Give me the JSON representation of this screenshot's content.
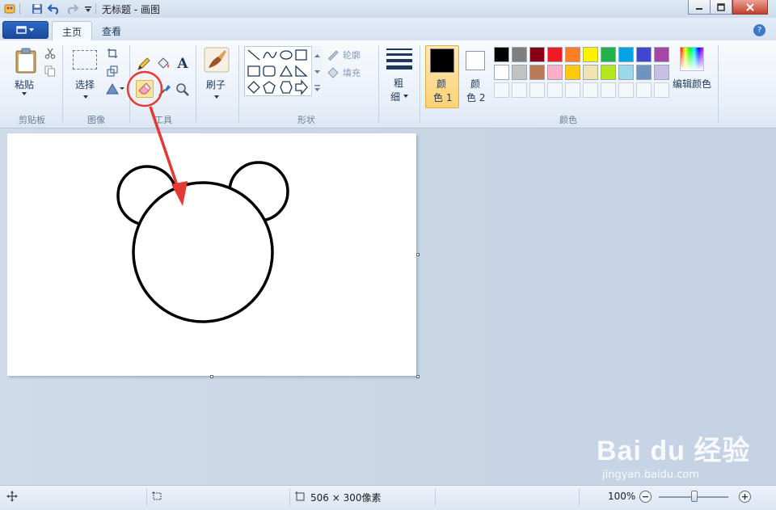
{
  "window": {
    "title": "无标题 - 画图"
  },
  "tabs": [
    {
      "label": "主页"
    },
    {
      "label": "查看"
    }
  ],
  "help_glyph": "?",
  "ribbon": {
    "clipboard": {
      "paste": "粘贴",
      "group": "剪贴板"
    },
    "image": {
      "select": "选择",
      "group": "图像"
    },
    "tools": {
      "group": "工具",
      "text_glyph": "A"
    },
    "brushes": {
      "label": "刷子"
    },
    "shapes": {
      "outline": "轮廓",
      "fill": "填充",
      "group": "形状"
    },
    "size": {
      "line1": "粗",
      "line2": "细"
    },
    "color1": {
      "line1": "颜",
      "line2": "色 1",
      "value": "#000000"
    },
    "color2": {
      "line1": "颜",
      "line2": "色 2",
      "value": "#ffffff"
    },
    "edit_colors": "编辑颜色",
    "colors_group": "颜色",
    "palette_row1": [
      "#000000",
      "#7f7f7f",
      "#880015",
      "#ed1c24",
      "#ff7f27",
      "#fff200",
      "#22b14c",
      "#00a2e8",
      "#3f48cc",
      "#a349a4"
    ],
    "palette_row2": [
      "#ffffff",
      "#c3c3c3",
      "#b97a57",
      "#ffaec9",
      "#ffc90e",
      "#efe4b0",
      "#b5e61d",
      "#99d9ea",
      "#7092be",
      "#c8bfe7"
    ]
  },
  "status": {
    "size": "506 × 300像素",
    "zoom": "100%"
  },
  "watermark": {
    "brand": "Bai du 经验",
    "url": "jingyan.baidu.com"
  },
  "highlight_color": "#e53935"
}
